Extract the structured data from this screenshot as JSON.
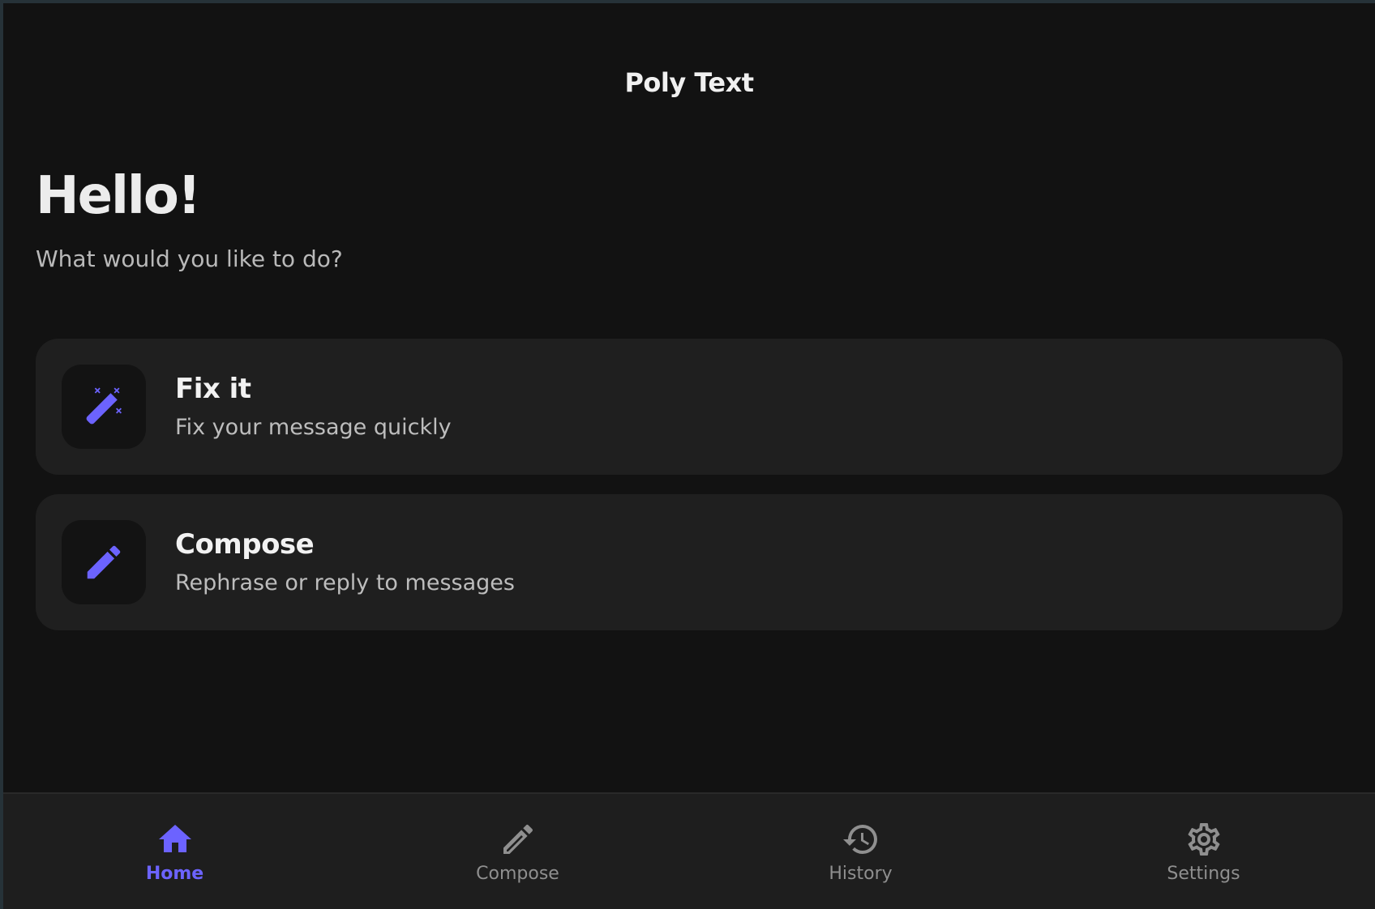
{
  "app_bar": {
    "title": "Poly Text"
  },
  "main": {
    "greeting": "Hello!",
    "prompt": "What would you like to do?",
    "actions": [
      {
        "title": "Fix it",
        "subtitle": "Fix your message quickly",
        "icon": "magic-wand-icon"
      },
      {
        "title": "Compose",
        "subtitle": "Rephrase or reply to messages",
        "icon": "pencil-icon"
      }
    ]
  },
  "bottom_nav": {
    "items": [
      {
        "label": "Home",
        "icon": "home-icon",
        "active": true
      },
      {
        "label": "Compose",
        "icon": "pencil-icon",
        "active": false
      },
      {
        "label": "History",
        "icon": "history-icon",
        "active": false
      },
      {
        "label": "Settings",
        "icon": "gear-icon",
        "active": false
      }
    ]
  },
  "colors": {
    "accent": "#6c63ff",
    "background": "#121212",
    "card": "#1f1f1f",
    "nav_inactive": "#8f8f8f"
  }
}
